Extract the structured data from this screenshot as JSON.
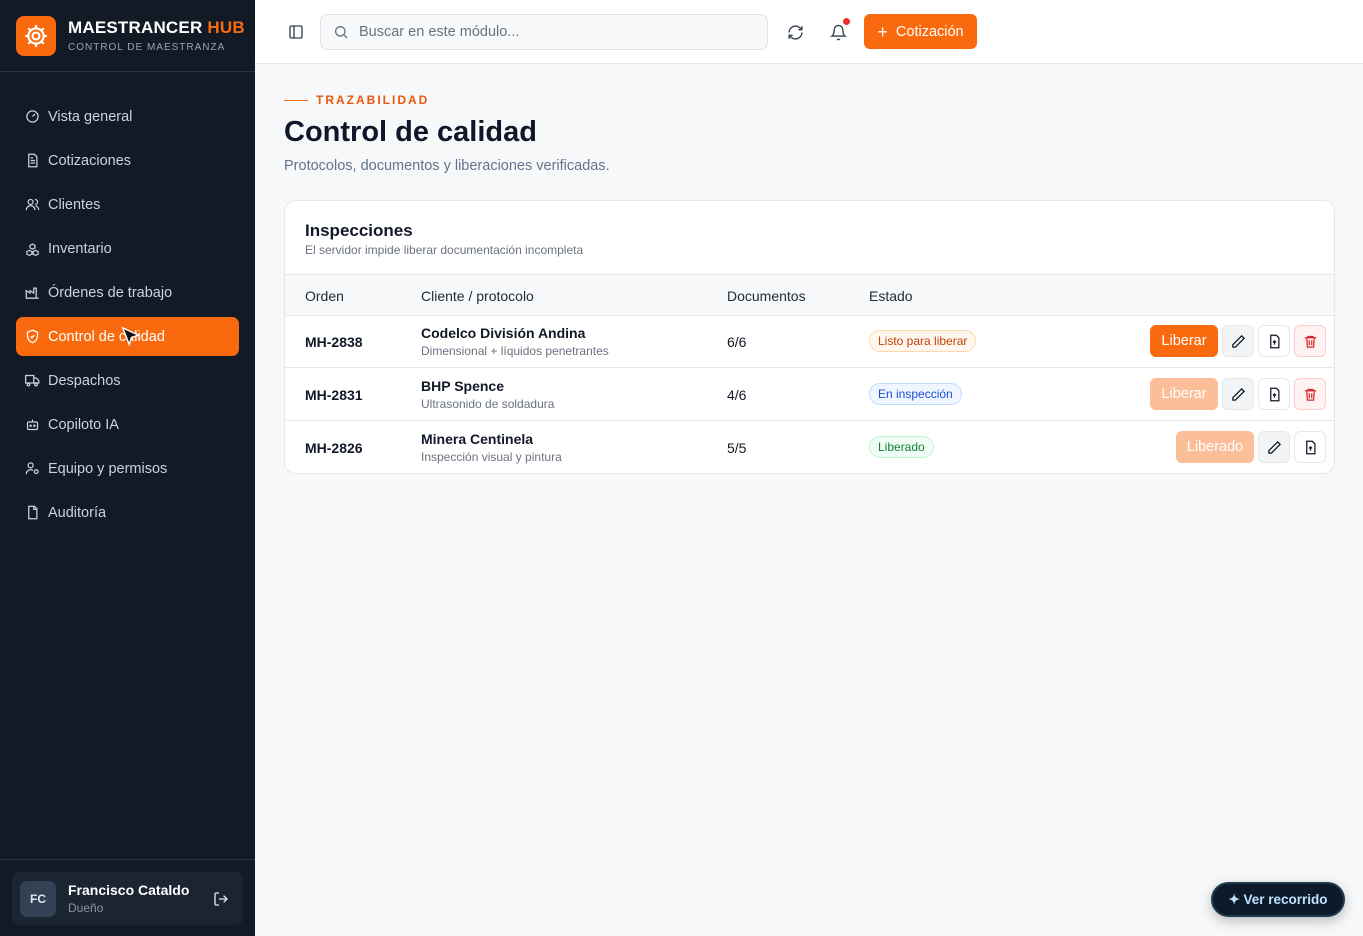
{
  "brand": {
    "name": "MAESTRANCER",
    "name_accent": "HUB",
    "subtitle": "CONTROL DE MAESTRANZA"
  },
  "nav": {
    "items": [
      {
        "label": "Vista general",
        "icon": "gauge-icon"
      },
      {
        "label": "Cotizaciones",
        "icon": "document-icon"
      },
      {
        "label": "Clientes",
        "icon": "users-icon"
      },
      {
        "label": "Inventario",
        "icon": "boxes-icon"
      },
      {
        "label": "Órdenes de trabajo",
        "icon": "factory-icon"
      },
      {
        "label": "Control de calidad",
        "icon": "shield-check-icon",
        "active": true
      },
      {
        "label": "Despachos",
        "icon": "truck-icon"
      },
      {
        "label": "Copiloto IA",
        "icon": "bot-icon"
      },
      {
        "label": "Equipo y permisos",
        "icon": "user-cog-icon"
      },
      {
        "label": "Auditoría",
        "icon": "file-icon"
      }
    ]
  },
  "user": {
    "initials": "FC",
    "name": "Francisco Cataldo",
    "role": "Dueño"
  },
  "topbar": {
    "search_placeholder": "Buscar en este módulo...",
    "primary_button": "Cotización"
  },
  "page": {
    "eyebrow": "TRAZABILIDAD",
    "title": "Control de calidad",
    "subtitle": "Protocolos, documentos y liberaciones verificadas."
  },
  "inspections": {
    "title": "Inspecciones",
    "subtitle": "El servidor impide liberar documentación incompleta",
    "columns": [
      "Orden",
      "Cliente / protocolo",
      "Documentos",
      "Estado"
    ],
    "rows": [
      {
        "order": "MH-2838",
        "client": "Codelco División Andina",
        "protocol": "Dimensional + líquidos penetrantes",
        "docs": "6/6",
        "status": "Listo para liberar",
        "status_color": "#c2410c",
        "action": "Liberar",
        "action_enabled": true
      },
      {
        "order": "MH-2831",
        "client": "BHP Spence",
        "protocol": "Ultrasonido de soldadura",
        "docs": "4/6",
        "status": "En inspección",
        "status_color": "#1d4ed8",
        "action": "Liberar",
        "action_enabled": false
      },
      {
        "order": "MH-2826",
        "client": "Minera Centinela",
        "protocol": "Inspección visual y pintura",
        "docs": "5/5",
        "status": "Liberado",
        "status_color": "#15803d",
        "action": "Liberado",
        "action_enabled": false
      }
    ]
  },
  "tour_button": "✦ Ver recorrido",
  "colors": {
    "accent": "#f96a0e",
    "sidebar_bg": "#121a25"
  }
}
